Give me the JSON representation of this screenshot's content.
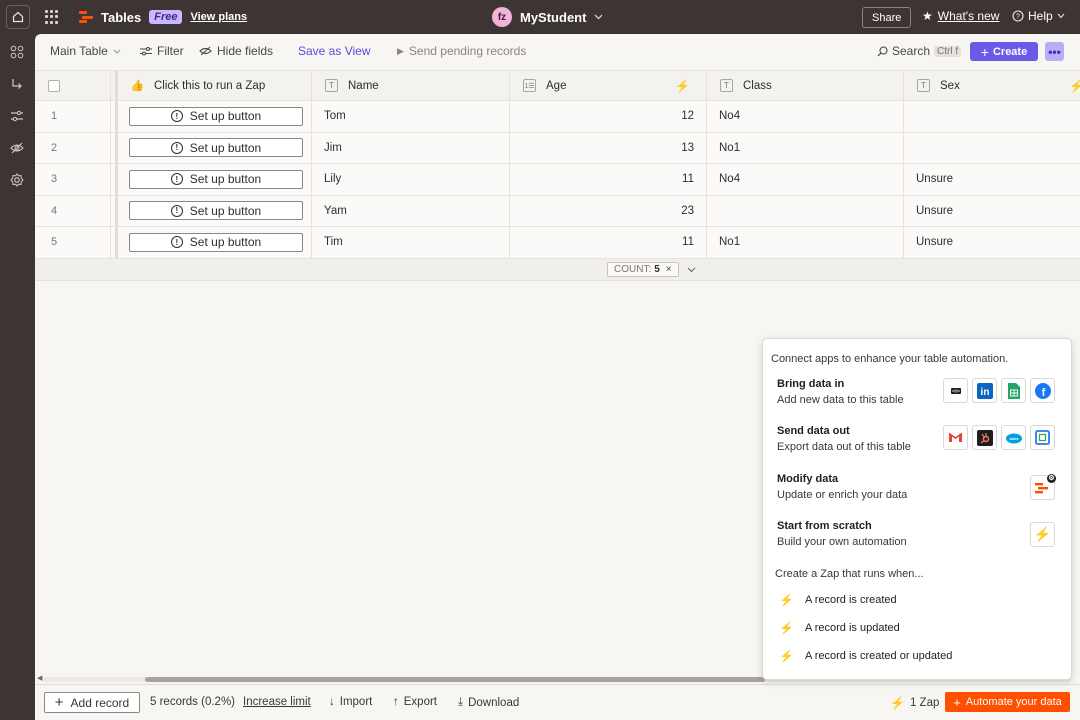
{
  "app": {
    "title": "Tables",
    "plan_badge": "Free",
    "view_plans": "View plans",
    "workspace_initials": "fz",
    "workspace_name": "MyStudent",
    "share": "Share",
    "whats_new": "What's new",
    "help": "Help"
  },
  "toolbar": {
    "view_name": "Main Table",
    "filter": "Filter",
    "hide_fields": "Hide fields",
    "save_as_view": "Save as View",
    "send_pending": "Send pending records",
    "search": "Search",
    "search_shortcut": "Ctrl f",
    "create": "Create"
  },
  "table": {
    "columns": {
      "zap": "Click this to run a Zap",
      "name": "Name",
      "age": "Age",
      "class": "Class",
      "sex": "Sex"
    },
    "button_label": "Set up button",
    "rows": [
      {
        "num": "1",
        "name": "Tom",
        "age": "12",
        "class": "No4",
        "sex": ""
      },
      {
        "num": "2",
        "name": "Jim",
        "age": "13",
        "class": "No1",
        "sex": ""
      },
      {
        "num": "3",
        "name": "Lily",
        "age": "11",
        "class": "No4",
        "sex": "Unsure"
      },
      {
        "num": "4",
        "name": "Yam",
        "age": "23",
        "class": "",
        "sex": "Unsure"
      },
      {
        "num": "5",
        "name": "Tim",
        "age": "11",
        "class": "No1",
        "sex": "Unsure"
      }
    ],
    "count_label": "COUNT:",
    "count_value": "5"
  },
  "popover": {
    "intro": "Connect apps to enhance your table automation.",
    "sections": [
      {
        "title": "Bring data in",
        "subtitle": "Add new data to this table",
        "apps": [
          "Intercom",
          "LinkedIn",
          "Google Sheets",
          "Facebook"
        ]
      },
      {
        "title": "Send data out",
        "subtitle": "Export data out of this table",
        "apps": [
          "Gmail",
          "HubSpot",
          "Salesforce",
          "Google Calendar"
        ]
      },
      {
        "title": "Modify data",
        "subtitle": "Update or enrich your data",
        "apps": [
          "Zapier Tables"
        ]
      },
      {
        "title": "Start from scratch",
        "subtitle": "Build your own automation",
        "apps": [
          "Zap"
        ]
      }
    ],
    "zap_heading": "Create a Zap that runs when...",
    "triggers": [
      "A record is created",
      "A record is updated",
      "A record is created or updated"
    ]
  },
  "footer": {
    "add_record": "Add record",
    "records_count": "5 records (0.2%)",
    "increase_limit": "Increase limit",
    "import": "Import",
    "export": "Export",
    "download": "Download",
    "zap_count": "1 Zap",
    "automate": "Automate your data"
  },
  "colors": {
    "brand_orange": "#ff4f00",
    "accent_purple": "#695be8",
    "chrome": "#3d3533"
  }
}
